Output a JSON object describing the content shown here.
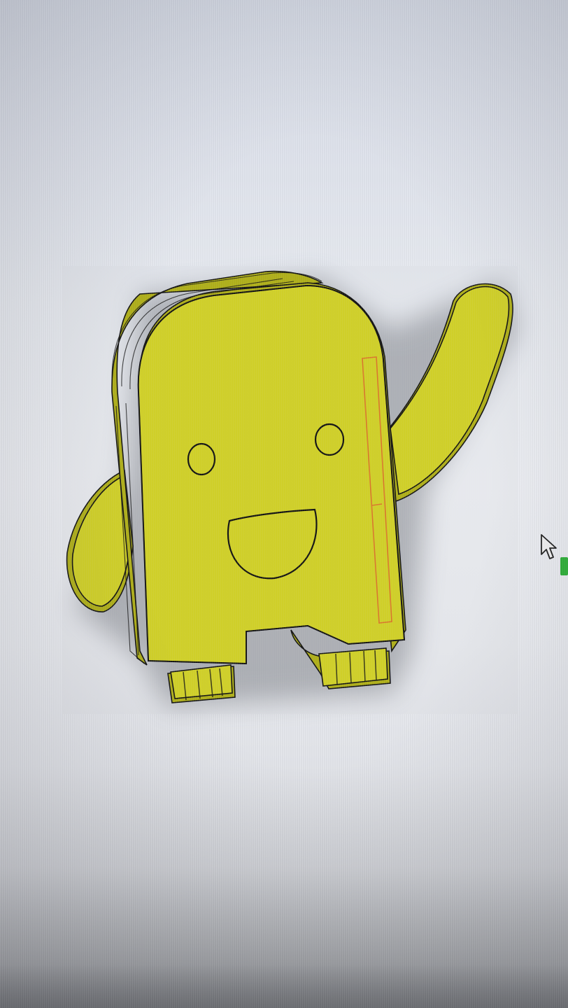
{
  "viewport": {
    "background_color": "#e9ecf2",
    "model": {
      "color": "#d6d62a",
      "shade_color": "#b4b41c",
      "edge_color": "#161616",
      "selection_color": "#e07a2e"
    }
  },
  "cursor": {
    "icon": "mouse-pointer-icon",
    "color": "#f4f4f4"
  },
  "status_indicator": {
    "color": "#2fb33a"
  }
}
